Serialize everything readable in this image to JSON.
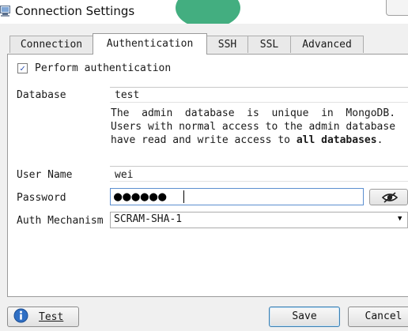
{
  "window": {
    "title": "Connection Settings",
    "app_icon": "monitor-icon",
    "close_icon": "close-icon"
  },
  "tabs": [
    {
      "label": "Connection",
      "active": false
    },
    {
      "label": "Authentication",
      "active": true
    },
    {
      "label": "SSH",
      "active": false
    },
    {
      "label": "SSL",
      "active": false
    },
    {
      "label": "Advanced",
      "active": false
    }
  ],
  "auth": {
    "perform_label": "Perform authentication",
    "perform_checked": true,
    "database_label": "Database",
    "database_value": "test",
    "note_line1": "The  admin  database  is  unique  in  MongoDB.",
    "note_line2": "Users with normal access to the admin database",
    "note_line3_prefix": "have read and write access to ",
    "note_line3_bold": "all databases",
    "note_line3_suffix": ".",
    "username_label": "User Name",
    "username_value": "wei",
    "password_label": "Password",
    "password_masked": "●●●●●●",
    "show_password_icon": "eye-icon",
    "mechanism_label": "Auth Mechanism",
    "mechanism_value": "SCRAM-SHA-1"
  },
  "buttons": {
    "test_label": "Test",
    "test_icon": "info-icon",
    "save_label": "Save",
    "cancel_label": "Cancel"
  },
  "colors": {
    "accent": "#3c7fb1",
    "title_blob": "#22a06a",
    "info_icon": "#2f6fc4"
  }
}
